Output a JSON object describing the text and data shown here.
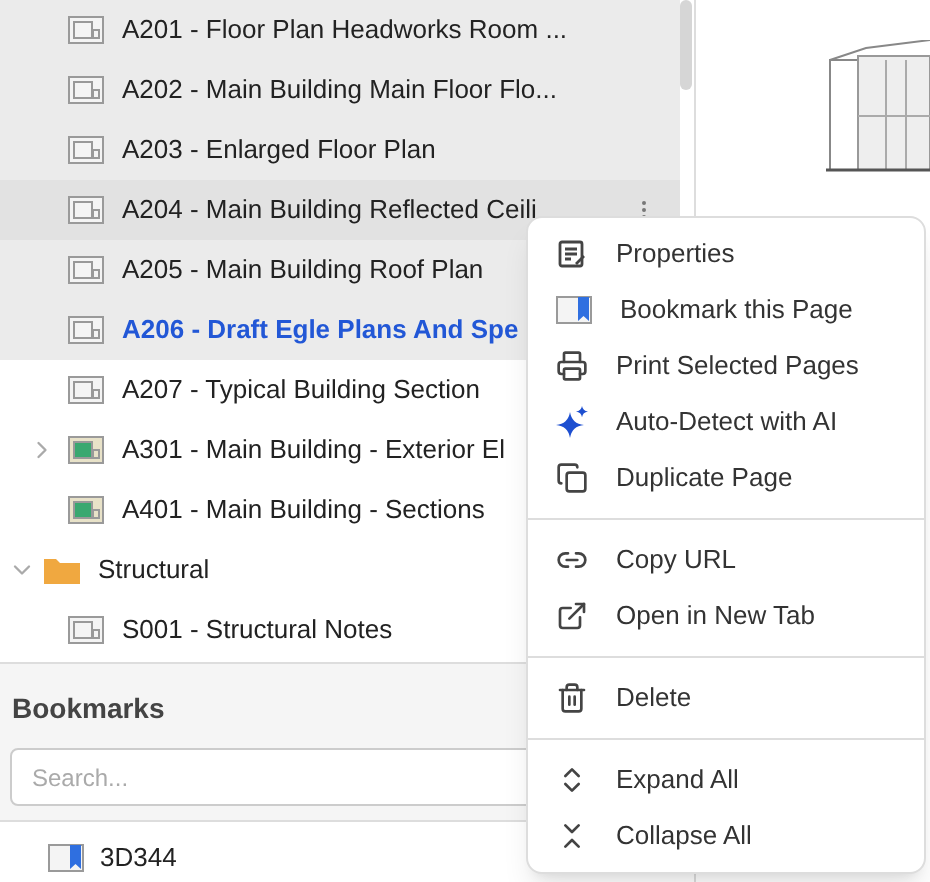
{
  "tree": [
    {
      "kind": "sheet",
      "label": "A201 - Floor Plan Headworks Room ...",
      "selected": true,
      "current": false,
      "hovered": false
    },
    {
      "kind": "sheet",
      "label": "A202 - Main Building Main Floor Flo...",
      "selected": true,
      "current": false,
      "hovered": false
    },
    {
      "kind": "sheet",
      "label": "A203 - Enlarged Floor Plan",
      "selected": true,
      "current": false,
      "hovered": false
    },
    {
      "kind": "sheet",
      "label": "A204 - Main Building Reflected Ceili",
      "selected": true,
      "current": false,
      "hovered": true
    },
    {
      "kind": "sheet",
      "label": "A205 - Main Building Roof Plan",
      "selected": true,
      "current": false,
      "hovered": false
    },
    {
      "kind": "sheet",
      "label": "A206 - Draft Egle Plans And Spe",
      "selected": true,
      "current": true,
      "hovered": false
    },
    {
      "kind": "sheet",
      "label": "A207 - Typical Building Section",
      "selected": false,
      "current": false,
      "hovered": false
    },
    {
      "kind": "sheet-color",
      "label": "A301 - Main Building - Exterior El",
      "selected": false,
      "current": false,
      "hovered": false,
      "expanded": false
    },
    {
      "kind": "sheet-color",
      "label": "A401 - Main Building - Sections",
      "selected": false,
      "current": false,
      "hovered": false
    },
    {
      "kind": "folder",
      "label": "Structural",
      "selected": false,
      "current": false,
      "hovered": false,
      "expanded": true,
      "children": [
        {
          "kind": "sheet",
          "label": "S001 - Structural Notes",
          "selected": false,
          "current": false,
          "hovered": false
        }
      ]
    }
  ],
  "bookmarks": {
    "title": "Bookmarks",
    "search": {
      "placeholder": "Search..."
    },
    "items": [
      {
        "label": "3D344"
      }
    ]
  },
  "context_menu": [
    {
      "kind": "properties",
      "label": "Properties"
    },
    {
      "kind": "bookmark",
      "label": "Bookmark this Page"
    },
    {
      "kind": "print",
      "label": "Print Selected Pages"
    },
    {
      "kind": "ai",
      "label": "Auto-Detect with AI"
    },
    {
      "kind": "duplicate",
      "label": "Duplicate Page"
    },
    {
      "kind": "divider"
    },
    {
      "kind": "link",
      "label": "Copy URL"
    },
    {
      "kind": "open",
      "label": "Open in New Tab"
    },
    {
      "kind": "divider"
    },
    {
      "kind": "delete",
      "label": "Delete"
    },
    {
      "kind": "divider"
    },
    {
      "kind": "expand",
      "label": "Expand All"
    },
    {
      "kind": "collapse",
      "label": "Collapse All"
    }
  ]
}
